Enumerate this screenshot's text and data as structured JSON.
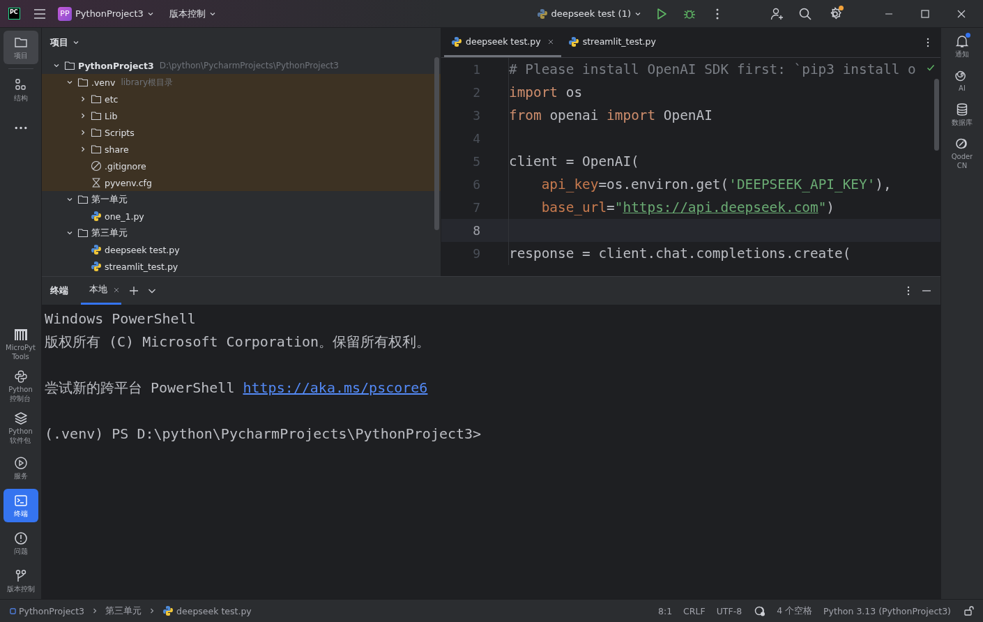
{
  "title_bar": {
    "logo": "PC",
    "project": {
      "badge": "PP",
      "name": "PythonProject3"
    },
    "vcs": "版本控制",
    "run_config": "deepseek test (1)",
    "settings_badge": true
  },
  "left_toolbar": {
    "top": [
      {
        "kind": "folder",
        "label": "项目",
        "selected": true
      },
      {
        "kind": "structure",
        "label": "结构",
        "selected": false
      },
      {
        "kind": "more",
        "selected": false
      }
    ],
    "bottom": [
      {
        "kind": "micropython",
        "label": "MicroPyt\nTools",
        "selected": false
      },
      {
        "kind": "python",
        "label": "Python\n控制台",
        "selected": false
      },
      {
        "kind": "layers",
        "label": "Python\n软件包",
        "selected": false
      },
      {
        "kind": "services",
        "label": "服务",
        "selected": false
      },
      {
        "kind": "terminal",
        "label": "终端",
        "selected": true
      },
      {
        "kind": "problems",
        "label": "问题",
        "selected": false
      },
      {
        "kind": "vcs",
        "label": "版本控制",
        "selected": false
      }
    ]
  },
  "project_panel": {
    "title": "项目",
    "tree": [
      {
        "kind": "project",
        "name": "PythonProject3",
        "hint": "D:\\python\\PycharmProjects\\PythonProject3",
        "expanded": true,
        "children": [
          {
            "kind": "folder",
            "name": ".venv",
            "hint": "library根目录",
            "expanded": true,
            "excluded": true,
            "children": [
              {
                "kind": "folder",
                "name": "etc",
                "expanded": false
              },
              {
                "kind": "folder",
                "name": "Lib",
                "expanded": false
              },
              {
                "kind": "folder",
                "name": "Scripts",
                "expanded": false
              },
              {
                "kind": "folder",
                "name": "share",
                "expanded": false
              },
              {
                "kind": "ignore",
                "name": ".gitignore"
              },
              {
                "kind": "config",
                "name": "pyvenv.cfg"
              }
            ]
          },
          {
            "kind": "folder",
            "name": "第一单元",
            "expanded": true,
            "children": [
              {
                "kind": "python",
                "name": "one_1.py"
              }
            ]
          },
          {
            "kind": "folder",
            "name": "第三单元",
            "expanded": true,
            "children": [
              {
                "kind": "python",
                "name": "deepseek test.py"
              },
              {
                "kind": "python",
                "name": "streamlit_test.py"
              }
            ]
          }
        ]
      }
    ]
  },
  "editor": {
    "tabs": [
      {
        "label": "deepseek test.py",
        "selected": true
      },
      {
        "label": "streamlit_test.py",
        "selected": false
      }
    ],
    "lines": [
      {
        "number": "1",
        "current": false,
        "tokens": [
          {
            "kind": "comment",
            "text": "# Please install OpenAI SDK first: `pip3 install o"
          }
        ]
      },
      {
        "number": "2",
        "current": false,
        "tokens": [
          {
            "kind": "keyword",
            "text": "import"
          },
          {
            "kind": "plain",
            "text": " os"
          }
        ]
      },
      {
        "number": "3",
        "current": false,
        "tokens": [
          {
            "kind": "keyword",
            "text": "from"
          },
          {
            "kind": "plain",
            "text": " openai "
          },
          {
            "kind": "keyword",
            "text": "import"
          },
          {
            "kind": "plain",
            "text": " OpenAI"
          }
        ]
      },
      {
        "number": "4",
        "current": false
      },
      {
        "number": "5",
        "current": false,
        "tokens": [
          {
            "kind": "plain",
            "text": "client = OpenAI("
          }
        ]
      },
      {
        "number": "6",
        "current": false,
        "indented": true,
        "tokens": [
          {
            "kind": "param",
            "text": "api_key"
          },
          {
            "kind": "plain",
            "text": "=os.environ.get("
          },
          {
            "kind": "string",
            "text": "'DEEPSEEK_API_KEY'"
          },
          {
            "kind": "plain",
            "text": "),"
          }
        ]
      },
      {
        "number": "7",
        "current": false,
        "indented": true,
        "tokens": [
          {
            "kind": "param",
            "text": "base_url"
          },
          {
            "kind": "plain",
            "text": "="
          },
          {
            "kind": "string",
            "text": "\""
          },
          {
            "kind": "link",
            "text": "https://api.deepseek.com"
          },
          {
            "kind": "string",
            "text": "\""
          },
          {
            "kind": "plain",
            "text": ")"
          }
        ]
      },
      {
        "number": "8",
        "current": true
      },
      {
        "number": "9",
        "current": false,
        "tokens": [
          {
            "kind": "plain",
            "text": "response = client.chat.completions.create("
          }
        ]
      }
    ]
  },
  "right_toolbar": [
    {
      "kind": "bell",
      "label": "通知",
      "badge": true
    },
    {
      "kind": "spiral",
      "label": "AI",
      "badge": false
    },
    {
      "kind": "database",
      "label": "数据库",
      "badge": false
    },
    {
      "kind": "qoder",
      "label": "Qoder\nCN",
      "badge": false
    }
  ],
  "terminal": {
    "title": "终端",
    "tabs": [
      {
        "label": "本地",
        "selected": true
      }
    ],
    "lines": [
      {
        "kind": "output",
        "segments": [
          {
            "kind": "plain",
            "text": "Windows PowerShell"
          }
        ]
      },
      {
        "kind": "output",
        "segments": [
          {
            "kind": "plain",
            "text": "版权所有 (C) Microsoft Corporation。保留所有权利。"
          }
        ]
      },
      {
        "kind": "blank"
      },
      {
        "kind": "output",
        "segments": [
          {
            "kind": "plain",
            "text": "尝试新的跨平台 PowerShell "
          },
          {
            "kind": "link",
            "text": "https://aka.ms/pscore6"
          }
        ]
      },
      {
        "kind": "blank"
      },
      {
        "kind": "output",
        "segments": [
          {
            "kind": "plain",
            "text": "(.venv) PS D:\\python\\PycharmProjects\\PythonProject3>"
          }
        ]
      }
    ]
  },
  "status_bar": {
    "breadcrumbs": [
      {
        "kind": "module",
        "text": "PythonProject3"
      },
      {
        "kind": "folder",
        "text": "第三单元"
      },
      {
        "kind": "python",
        "text": "deepseek test.py"
      }
    ],
    "items": [
      {
        "kind": "text",
        "text": "8:1"
      },
      {
        "kind": "text",
        "text": "CRLF"
      },
      {
        "kind": "text",
        "text": "UTF-8"
      },
      {
        "kind": "ai-icon"
      },
      {
        "kind": "text",
        "text": "4 个空格"
      },
      {
        "kind": "text",
        "text": "Python 3.13 (PythonProject3)"
      },
      {
        "kind": "lock-icon"
      }
    ]
  }
}
